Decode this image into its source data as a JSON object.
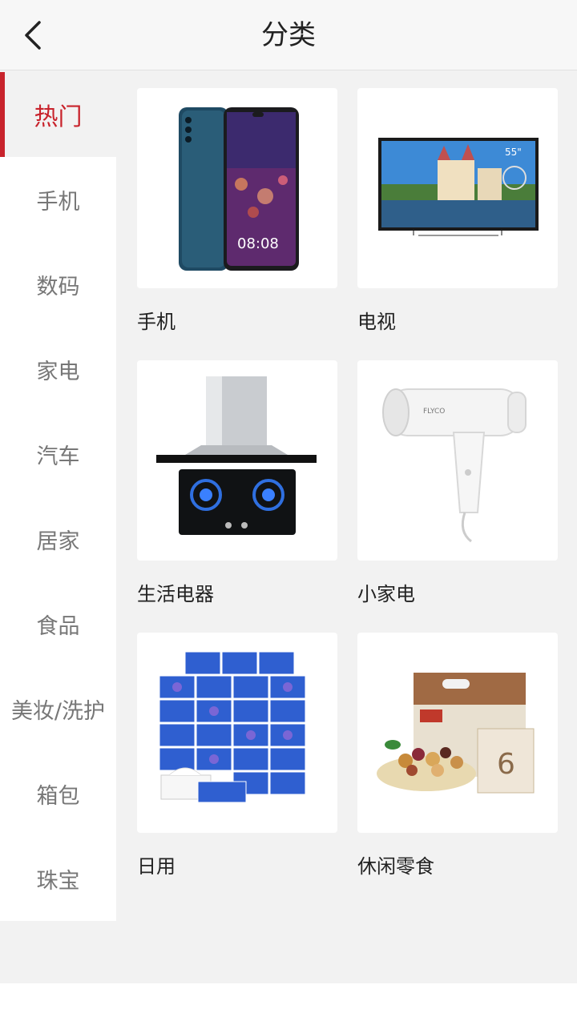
{
  "header": {
    "title": "分类",
    "back_icon": "chevron-left-icon"
  },
  "sidebar": {
    "items": [
      {
        "label": "热门",
        "active": true
      },
      {
        "label": "手机"
      },
      {
        "label": "数码"
      },
      {
        "label": "家电"
      },
      {
        "label": "汽车"
      },
      {
        "label": "居家"
      },
      {
        "label": "食品"
      },
      {
        "label": "美妆/洗护"
      },
      {
        "label": "箱包"
      },
      {
        "label": "珠宝"
      }
    ]
  },
  "main": {
    "products": [
      {
        "label": "手机",
        "icon": "smartphone-image"
      },
      {
        "label": "电视",
        "icon": "tv-image"
      },
      {
        "label": "生活电器",
        "icon": "range-hood-stove-image"
      },
      {
        "label": "小家电",
        "icon": "hair-dryer-image"
      },
      {
        "label": "日用",
        "icon": "tissue-boxes-image"
      },
      {
        "label": "休闲零食",
        "icon": "snack-box-image"
      }
    ]
  },
  "colors": {
    "accent": "#c8232c",
    "background": "#f2f2f2"
  }
}
